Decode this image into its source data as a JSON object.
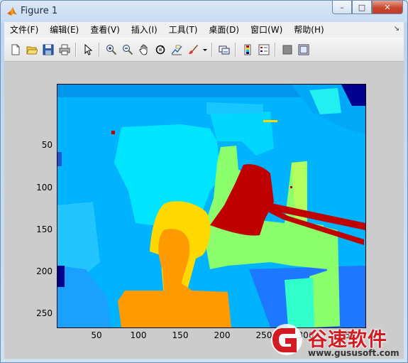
{
  "window": {
    "title": "Figure 1",
    "min": "–",
    "max": "□",
    "close": "✕"
  },
  "menu": [
    "文件(F)",
    "编辑(E)",
    "查看(V)",
    "插入(I)",
    "工具(T)",
    "桌面(D)",
    "窗口(W)",
    "帮助(H)"
  ],
  "menu_arrow": "↘",
  "toolbar_icons": [
    "new-figure-icon",
    "open-file-icon",
    "save-icon",
    "print-icon",
    "pointer-icon",
    "zoom-in-icon",
    "zoom-out-icon",
    "pan-hand-icon",
    "rotate-3d-icon",
    "data-cursor-icon",
    "brush-icon",
    "brush-dropdown-icon",
    "link-plot-icon",
    "colorbar-icon",
    "legend-icon",
    "hide-plot-tools-icon",
    "show-plot-tools-icon"
  ],
  "axes": {
    "y_ticks": [
      "50",
      "100",
      "150",
      "200",
      "250"
    ],
    "x_ticks": [
      "50",
      "100",
      "150",
      "200",
      "250",
      "300",
      "350"
    ],
    "colormap": "jet",
    "colors": {
      "background": "#00b3ff",
      "cyan": "#00e5ff",
      "light_cyan": "#22f0f0",
      "green": "#8cff6c",
      "teal": "#30ffcc",
      "yellow": "#ffd800",
      "orange": "#ff9b00",
      "red": "#c00000",
      "blue": "#1e78ff",
      "navy": "#00008f"
    }
  },
  "watermark": {
    "name": "谷速软件",
    "url": "www.gususoft.com"
  }
}
